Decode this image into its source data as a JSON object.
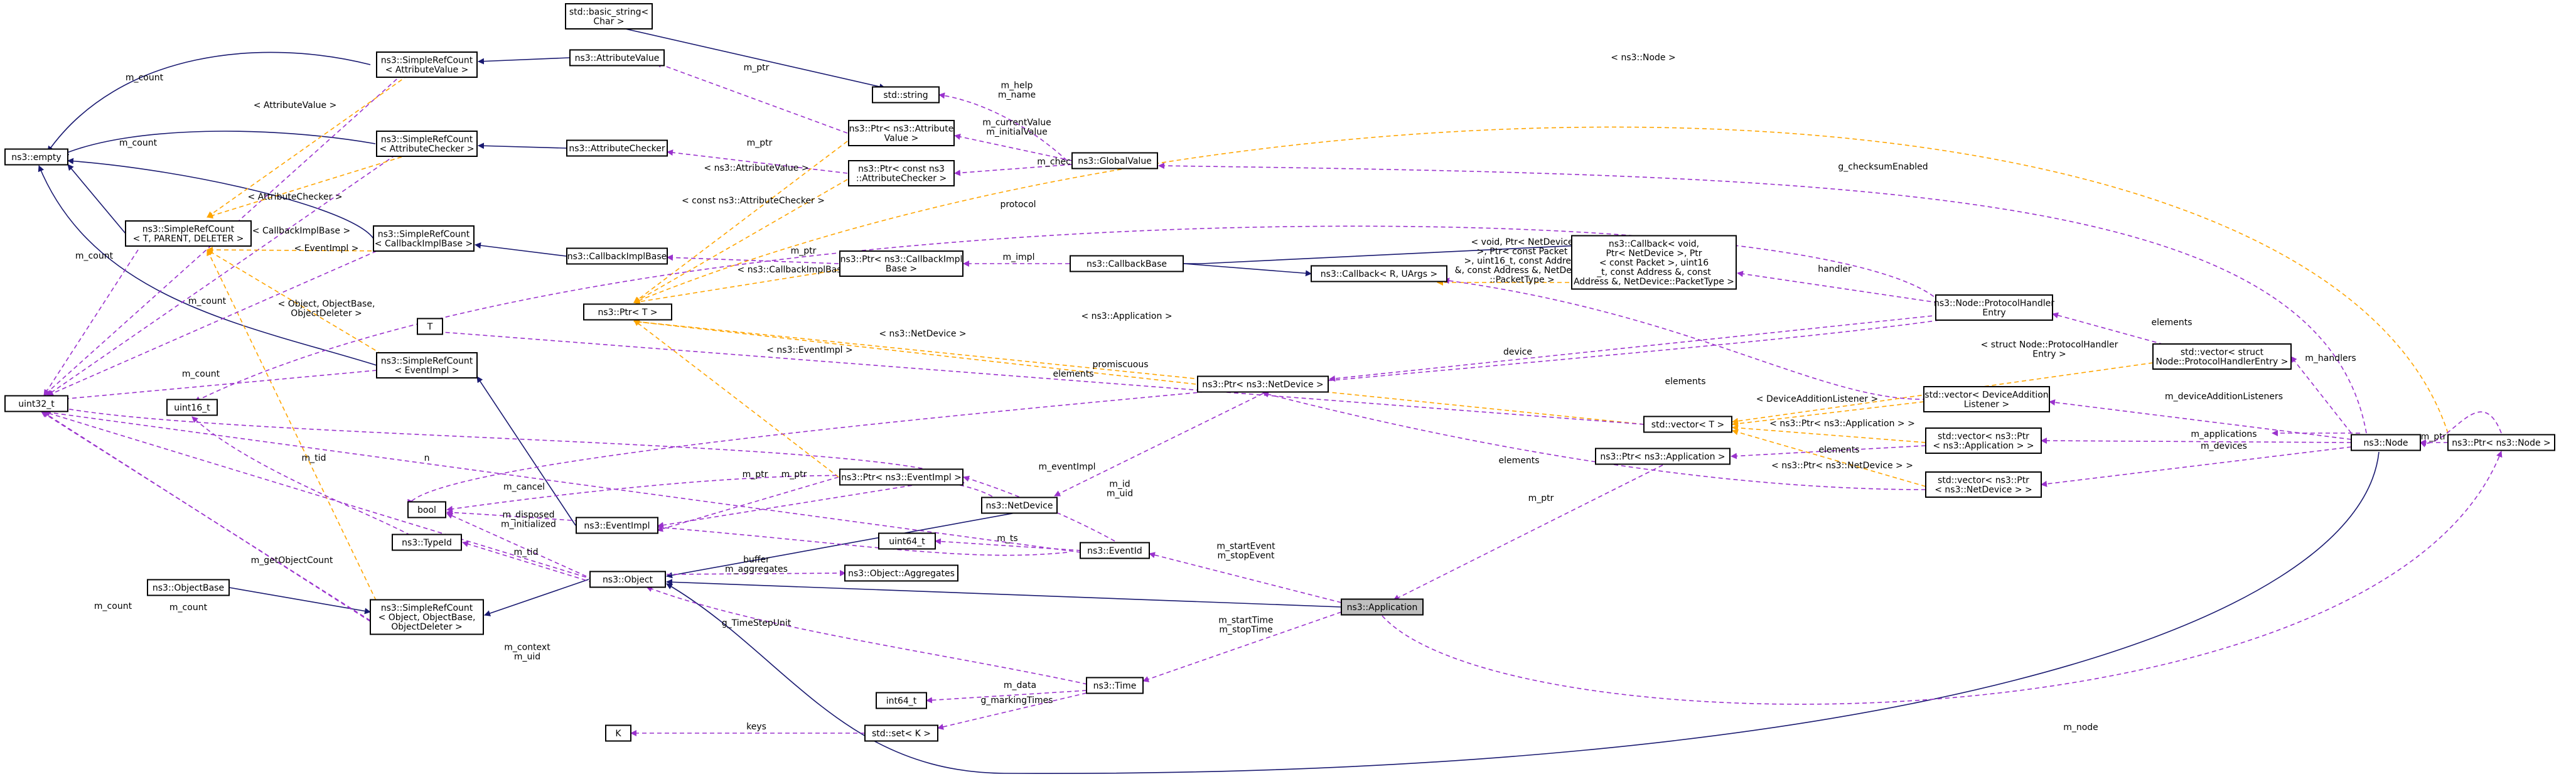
{
  "colors": {
    "inherit": "#191970",
    "use": "#9a32cd",
    "template": "#ffa500",
    "highlight": "#bfbfbf"
  },
  "nodes": {
    "basic_string": [
      "std::basic_string<",
      "Char >"
    ],
    "empty": [
      "ns3::empty"
    ],
    "src_attrval": [
      "ns3::SimpleRefCount",
      "< AttributeValue >"
    ],
    "attrval": [
      "ns3::AttributeValue"
    ],
    "src_attrchk": [
      "ns3::SimpleRefCount",
      "< AttributeChecker >"
    ],
    "attrchk": [
      "ns3::AttributeChecker"
    ],
    "src_t": [
      "ns3::SimpleRefCount",
      "< T, PARENT, DELETER >"
    ],
    "src_cbimpl": [
      "ns3::SimpleRefCount",
      "< CallbackImplBase >"
    ],
    "cbimplbase": [
      "ns3::CallbackImplBase"
    ],
    "t": [
      "T"
    ],
    "uint16": [
      "uint16_t"
    ],
    "uint32": [
      "uint32_t"
    ],
    "src_event": [
      "ns3::SimpleRefCount",
      "< EventImpl >"
    ],
    "eventimpl": [
      "ns3::EventImpl"
    ],
    "bool": [
      "bool"
    ],
    "typeid": [
      "ns3::TypeId"
    ],
    "objectbase": [
      "ns3::ObjectBase"
    ],
    "src_obj": [
      "ns3::SimpleRefCount",
      "< Object, ObjectBase,",
      "ObjectDeleter >"
    ],
    "object": [
      "ns3::Object"
    ],
    "stdstring": [
      "std::string"
    ],
    "ptr_attrval": [
      "ns3::Ptr< ns3::Attribute",
      "Value >"
    ],
    "ptr_attrchk": [
      "ns3::Ptr< const ns3",
      "::AttributeChecker >"
    ],
    "globalvalue": [
      "ns3::GlobalValue"
    ],
    "ptr_cbimpl": [
      "ns3::Ptr< ns3::CallbackImpl",
      "Base >"
    ],
    "callbackbase": [
      "ns3::CallbackBase"
    ],
    "ptr_t": [
      "ns3::Ptr< T >"
    ],
    "ptr_eventimpl": [
      "ns3::Ptr< ns3::EventImpl >"
    ],
    "netdevice": [
      "ns3::NetDevice"
    ],
    "uint64_a": [
      "uint64_t"
    ],
    "eventid": [
      "ns3::EventId"
    ],
    "aggregates": [
      "ns3::Object::Aggregates"
    ],
    "application": [
      "ns3::Application"
    ],
    "int64": [
      "int64_t"
    ],
    "time": [
      "ns3::Time"
    ],
    "k": [
      "K"
    ],
    "stdset": [
      "std::set< K >"
    ],
    "callback_rua": [
      "ns3::Callback< R, UArgs >"
    ],
    "callback_void": [
      "ns3::Callback< void,",
      "Ptr< NetDevice >, Ptr",
      "< const Packet >, uint16",
      "_t, const Address &, const",
      "Address &, NetDevice::PacketType >"
    ],
    "protocolhandler": [
      "ns3::Node::ProtocolHandler",
      "Entry"
    ],
    "vec_phe": [
      "std::vector< struct",
      "Node::ProtocolHandlerEntry >"
    ],
    "ptr_netdevice": [
      "ns3::Ptr< ns3::NetDevice >"
    ],
    "vec_t": [
      "std::vector< T >"
    ],
    "vec_dal": [
      "std::vector< DeviceAddition",
      "Listener >"
    ],
    "ptr_app": [
      "ns3::Ptr< ns3::Application >"
    ],
    "vec_ptr_app": [
      "std::vector< ns3::Ptr",
      "< ns3::Application > >"
    ],
    "vec_ptr_nd": [
      "std::vector< ns3::Ptr",
      "< ns3::NetDevice > >"
    ],
    "node": [
      "ns3::Node"
    ],
    "ptr_node": [
      "ns3::Ptr< ns3::Node >"
    ]
  },
  "edge_labels": [
    {
      "lines": [
        "m_count"
      ]
    },
    {
      "lines": [
        "< AttributeValue >"
      ]
    },
    {
      "lines": [
        "m_count"
      ]
    },
    {
      "lines": [
        "< AttributeChecker >"
      ]
    },
    {
      "lines": [
        "< CallbackImplBase >"
      ]
    },
    {
      "lines": [
        "< EventImpl >"
      ]
    },
    {
      "lines": [
        "m_count"
      ]
    },
    {
      "lines": [
        "< Object, ObjectBase,",
        "ObjectDeleter >"
      ]
    },
    {
      "lines": [
        "m_count"
      ]
    },
    {
      "lines": [
        "m_count"
      ]
    },
    {
      "lines": [
        "m_count"
      ]
    },
    {
      "lines": [
        "m_ptr"
      ]
    },
    {
      "lines": [
        "m_ptr"
      ]
    },
    {
      "lines": [
        "< ns3::AttributeValue >"
      ]
    },
    {
      "lines": [
        "< const ns3::AttributeChecker >"
      ]
    },
    {
      "lines": [
        "m_ptr"
      ]
    },
    {
      "lines": [
        "< ns3::CallbackImplBase >"
      ]
    },
    {
      "lines": [
        "m_ptr"
      ]
    },
    {
      "lines": [
        "< ns3::EventImpl >"
      ]
    },
    {
      "lines": [
        "m_help",
        "m_name"
      ]
    },
    {
      "lines": [
        "m_currentValue",
        "m_initialValue"
      ]
    },
    {
      "lines": [
        "m_checker"
      ]
    },
    {
      "lines": [
        "g_checksumEnabled"
      ]
    },
    {
      "lines": [
        "protocol"
      ]
    },
    {
      "lines": [
        "m_impl"
      ]
    },
    {
      "lines": [
        "< void, Ptr< NetDevice",
        ">, Ptr< const Packet",
        ">, uint16_t, const Address",
        "&, const Address &, NetDevice",
        "::PacketType >"
      ]
    },
    {
      "lines": [
        "handler"
      ]
    },
    {
      "lines": [
        "elements"
      ]
    },
    {
      "lines": [
        "< ns3::Application >"
      ]
    },
    {
      "lines": [
        "< ns3::NetDevice >"
      ]
    },
    {
      "lines": [
        "device"
      ]
    },
    {
      "lines": [
        "promiscuous"
      ]
    },
    {
      "lines": [
        "elements"
      ]
    },
    {
      "lines": [
        "< struct Node::ProtocolHandler",
        "Entry >"
      ]
    },
    {
      "lines": [
        "elements"
      ]
    },
    {
      "lines": [
        "< DeviceAdditionListener >"
      ]
    },
    {
      "lines": [
        "< ns3::Ptr< ns3::Application > >"
      ]
    },
    {
      "lines": [
        "elements"
      ]
    },
    {
      "lines": [
        "< ns3::Ptr< ns3::NetDevice > >"
      ]
    },
    {
      "lines": [
        "elements"
      ]
    },
    {
      "lines": [
        "m_ptr"
      ]
    },
    {
      "lines": [
        "m_tid"
      ]
    },
    {
      "lines": [
        "n"
      ]
    },
    {
      "lines": [
        "m_cancel"
      ]
    },
    {
      "lines": [
        "m_ptr"
      ]
    },
    {
      "lines": [
        "m_eventImpl"
      ]
    },
    {
      "lines": [
        "m_id",
        "m_uid"
      ]
    },
    {
      "lines": [
        "m_disposed",
        "m_initialized"
      ]
    },
    {
      "lines": [
        "m_tid"
      ]
    },
    {
      "lines": [
        "buffer"
      ]
    },
    {
      "lines": [
        "m_aggregates"
      ]
    },
    {
      "lines": [
        "m_getObjectCount"
      ]
    },
    {
      "lines": [
        "m_count"
      ]
    },
    {
      "lines": [
        "m_ts"
      ]
    },
    {
      "lines": [
        "m_startEvent",
        "m_stopEvent"
      ]
    },
    {
      "lines": [
        "m_context",
        "m_uid"
      ]
    },
    {
      "lines": [
        "g_TimeStepUnit"
      ]
    },
    {
      "lines": [
        "m_startTime",
        "m_stopTime"
      ]
    },
    {
      "lines": [
        "m_data"
      ]
    },
    {
      "lines": [
        "g_markingTimes"
      ]
    },
    {
      "lines": [
        "keys"
      ]
    },
    {
      "lines": [
        "m_ptr"
      ]
    },
    {
      "lines": [
        "m_handlers"
      ]
    },
    {
      "lines": [
        "m_deviceAdditionListeners"
      ]
    },
    {
      "lines": [
        "m_applications"
      ]
    },
    {
      "lines": [
        "m_devices"
      ]
    },
    {
      "lines": [
        "m_ptr"
      ]
    },
    {
      "lines": [
        "< ns3::Node >"
      ]
    },
    {
      "lines": [
        "m_node"
      ]
    },
    {
      "lines": [
        "m_ptr"
      ]
    }
  ]
}
